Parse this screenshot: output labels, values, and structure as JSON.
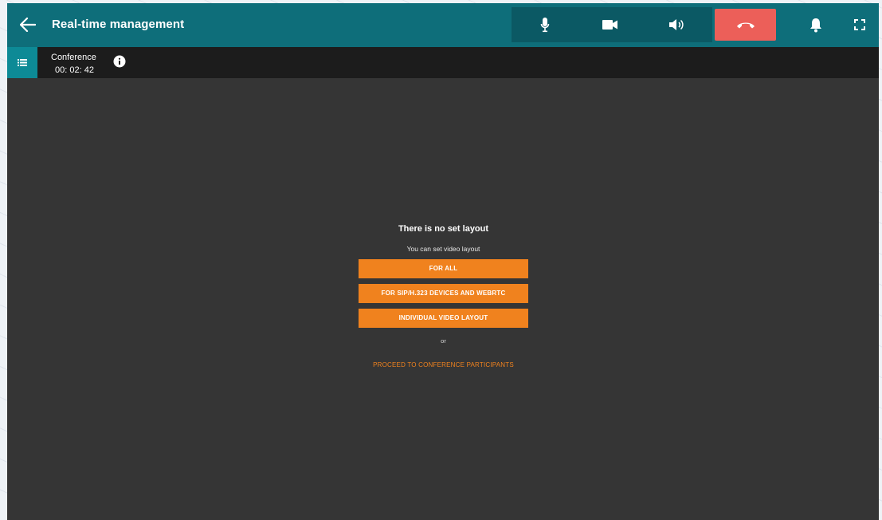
{
  "header": {
    "title": "Real-time management",
    "back_icon": "arrow-left-icon",
    "controls": [
      {
        "icon": "microphone-icon"
      },
      {
        "icon": "video-camera-icon"
      },
      {
        "icon": "speaker-icon"
      },
      {
        "icon": "hang-up-icon"
      }
    ],
    "notification_icon": "bell-icon",
    "fullscreen_icon": "fullscreen-icon"
  },
  "conference": {
    "label": "Conference",
    "timer": "00: 02: 42",
    "info_icon": "info-icon",
    "list_icon": "list-icon"
  },
  "layout_panel": {
    "heading": "There is no set layout",
    "subheading": "You can set video layout",
    "buttons": [
      "FOR ALL",
      "FOR SIP/H.323 DEVICES AND WEBRTC",
      "INDIVIDUAL VIDEO LAYOUT"
    ],
    "or_text": "or",
    "proceed_link": "PROCEED TO CONFERENCE PARTICIPANTS"
  },
  "colors": {
    "header_bg": "#0e6e7a",
    "controls_bg": "#0b5964",
    "hangup": "#ec5f59",
    "accent_orange": "#f0821e",
    "content_bg": "#353535",
    "subbar_bg": "#1c1c1c"
  }
}
